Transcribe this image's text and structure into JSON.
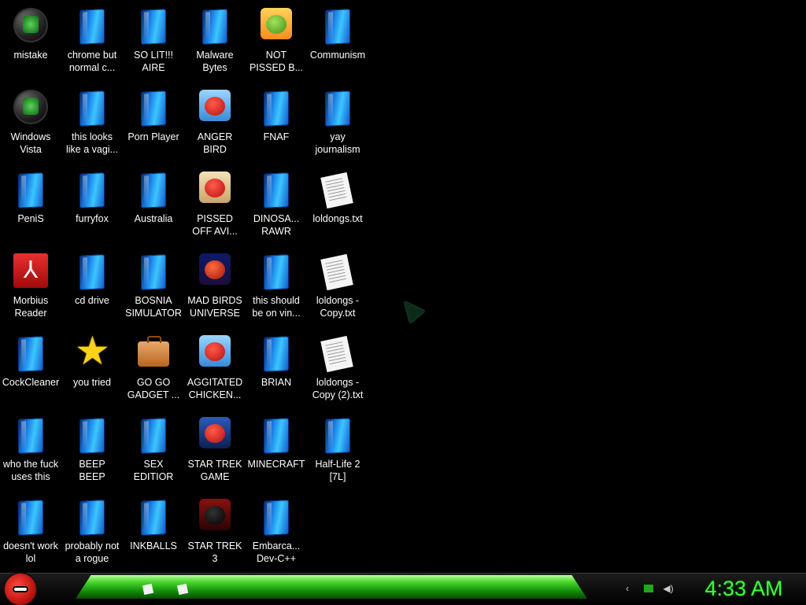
{
  "desktop": {
    "icons": [
      {
        "label": "mistake",
        "icon": "green-orb-icon"
      },
      {
        "label": "chrome but\nnormal c...",
        "icon": "shortcut-icon"
      },
      {
        "label": "SO LIT!!!\nAIRE",
        "icon": "shortcut-icon"
      },
      {
        "label": "Malware\nBytes",
        "icon": "shortcut-icon"
      },
      {
        "label": "NOT\nPISSED B...",
        "icon": "pig-app-icon"
      },
      {
        "label": "Communism",
        "icon": "shortcut-icon"
      },
      {
        "label": "Windows\nVista",
        "icon": "recycle-orb-icon"
      },
      {
        "label": "this looks\nlike a vagi...",
        "icon": "shortcut-icon"
      },
      {
        "label": "Porn Player",
        "icon": "shortcut-icon"
      },
      {
        "label": "ANGER\nBIRD",
        "icon": "bird-app-icon"
      },
      {
        "label": "FNAF",
        "icon": "shortcut-icon"
      },
      {
        "label": "yay\njournalism",
        "icon": "shortcut-icon"
      },
      {
        "label": "PeniS",
        "icon": "shortcut-icon"
      },
      {
        "label": "furryfox",
        "icon": "shortcut-icon"
      },
      {
        "label": "Australia",
        "icon": "shortcut-icon"
      },
      {
        "label": "PISSED\nOFF AVI...",
        "icon": "seasons-app-icon"
      },
      {
        "label": "DINOSA...\nRAWR",
        "icon": "shortcut-icon"
      },
      {
        "label": "loldongs.txt",
        "icon": "text-file-icon"
      },
      {
        "label": "Morbius\nReader",
        "icon": "pdf-reader-icon"
      },
      {
        "label": "cd drive",
        "icon": "shortcut-icon"
      },
      {
        "label": "BOSNIA\nSIMULATOR",
        "icon": "shortcut-icon"
      },
      {
        "label": "MAD BIRDS\nUNIVERSE",
        "icon": "space-bird-app-icon"
      },
      {
        "label": "this should\nbe on vin...",
        "icon": "shortcut-icon"
      },
      {
        "label": "loldongs -\nCopy.txt",
        "icon": "text-file-icon"
      },
      {
        "label": "CockCleaner",
        "icon": "shortcut-icon"
      },
      {
        "label": "you tried",
        "icon": "star-icon"
      },
      {
        "label": "GO GO\nGADGET ...",
        "icon": "briefcase-icon"
      },
      {
        "label": "AGGITATED\nCHICKEN...",
        "icon": "bird-app-icon"
      },
      {
        "label": "BRIAN",
        "icon": "shortcut-icon"
      },
      {
        "label": "loldongs -\nCopy (2).txt",
        "icon": "text-file-icon"
      },
      {
        "label": "who the fuck\nuses this",
        "icon": "shortcut-icon"
      },
      {
        "label": "BEEP\nBEEP",
        "icon": "shortcut-icon"
      },
      {
        "label": "SEX\nEDITIOR",
        "icon": "shortcut-icon"
      },
      {
        "label": "STAR TREK\nGAME",
        "icon": "starwars-bird-icon"
      },
      {
        "label": "MINECRAFT",
        "icon": "shortcut-icon"
      },
      {
        "label": "Half-Life 2\n[7L]",
        "icon": "shortcut-icon"
      },
      {
        "label": "doesn't work\nlol",
        "icon": "shortcut-icon"
      },
      {
        "label": "probably not\na rogue",
        "icon": "shortcut-icon"
      },
      {
        "label": "INKBALLS",
        "icon": "shortcut-icon"
      },
      {
        "label": "STAR TREK\n3",
        "icon": "starwars-dark-icon"
      },
      {
        "label": "Embarca...\nDev-C++",
        "icon": "shortcut-icon"
      }
    ]
  },
  "taskbar": {
    "start_icon": "angry-bird-start-icon",
    "tasks": [
      {
        "icon": "document-icon"
      },
      {
        "icon": "document-icon"
      }
    ],
    "tray": [
      "back-arrow-icon",
      "network-icon",
      "speaker-icon"
    ],
    "clock": "4:33 AM"
  },
  "colors": {
    "accent": "#3cff3c",
    "taskbar_bar": "#46d62a",
    "desktop_bg": "#000000"
  }
}
